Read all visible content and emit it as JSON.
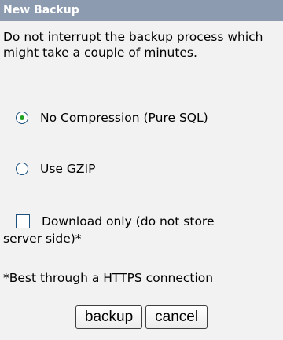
{
  "dialog": {
    "title": "New Backup",
    "intro": "Do not interrupt the backup process which might take a couple of minutes."
  },
  "options": {
    "no_compression": {
      "label": "No Compression (Pure SQL)",
      "selected": true
    },
    "gzip": {
      "label": "Use GZIP",
      "selected": false
    }
  },
  "download_only": {
    "line1": "Download only (do not store",
    "line2": "server side)*",
    "checked": false
  },
  "note": "*Best through a HTTPS connection",
  "buttons": {
    "backup": "backup",
    "cancel": "cancel"
  },
  "colors": {
    "title_bar": "#8c9bb0",
    "panel_bg": "#f2f2f2",
    "radio_dot": "#21a121",
    "control_border": "#1c5180"
  }
}
